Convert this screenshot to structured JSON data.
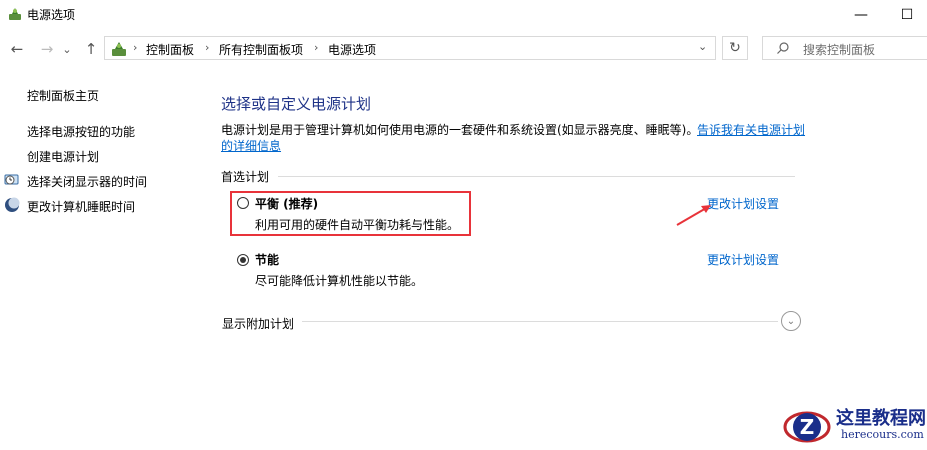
{
  "window": {
    "title": "电源选项",
    "minimize_glyph": "—",
    "maximize_glyph": "☐"
  },
  "nav": {
    "back_glyph": "←",
    "forward_glyph": "→",
    "recent_glyph": "⌄",
    "up_glyph": "↑",
    "breadcrumbs": [
      "控制面板",
      "所有控制面板项",
      "电源选项"
    ],
    "separator": "›",
    "dropdown_glyph": "⌄",
    "refresh_glyph": "↻",
    "search_placeholder": "搜索控制面板"
  },
  "sidebar": {
    "home": "控制面板主页",
    "items": [
      {
        "label": "选择电源按钮的功能",
        "icon": "none"
      },
      {
        "label": "创建电源计划",
        "icon": "none"
      },
      {
        "label": "选择关闭显示器的时间",
        "icon": "clock-monitor-icon"
      },
      {
        "label": "更改计算机睡眠时间",
        "icon": "moon-icon"
      }
    ]
  },
  "main": {
    "heading": "选择或自定义电源计划",
    "description": "电源计划是用于管理计算机如何使用电源的一套硬件和系统设置(如显示器亮度、睡眠等)。",
    "learn_more_1": "告诉我有关电源计划",
    "learn_more_2": "的详细信息",
    "section_title": "首选计划",
    "plans": [
      {
        "name": "平衡 (推荐)",
        "desc": "利用可用的硬件自动平衡功耗与性能。",
        "selected": false,
        "change_label": "更改计划设置"
      },
      {
        "name": "节能",
        "desc": "尽可能降低计算机性能以节能。",
        "selected": true,
        "change_label": "更改计划设置"
      }
    ],
    "show_more": "显示附加计划",
    "expand_glyph": "⌄"
  },
  "annotation": {
    "box_color": "#e8333a",
    "arrow_color": "#e8333a"
  },
  "watermark": {
    "logo_letter": "Z",
    "text_cn": "这里教程网",
    "text_en": "herecours.com"
  },
  "colors": {
    "heading": "#1e3287",
    "link": "#0066cc"
  }
}
